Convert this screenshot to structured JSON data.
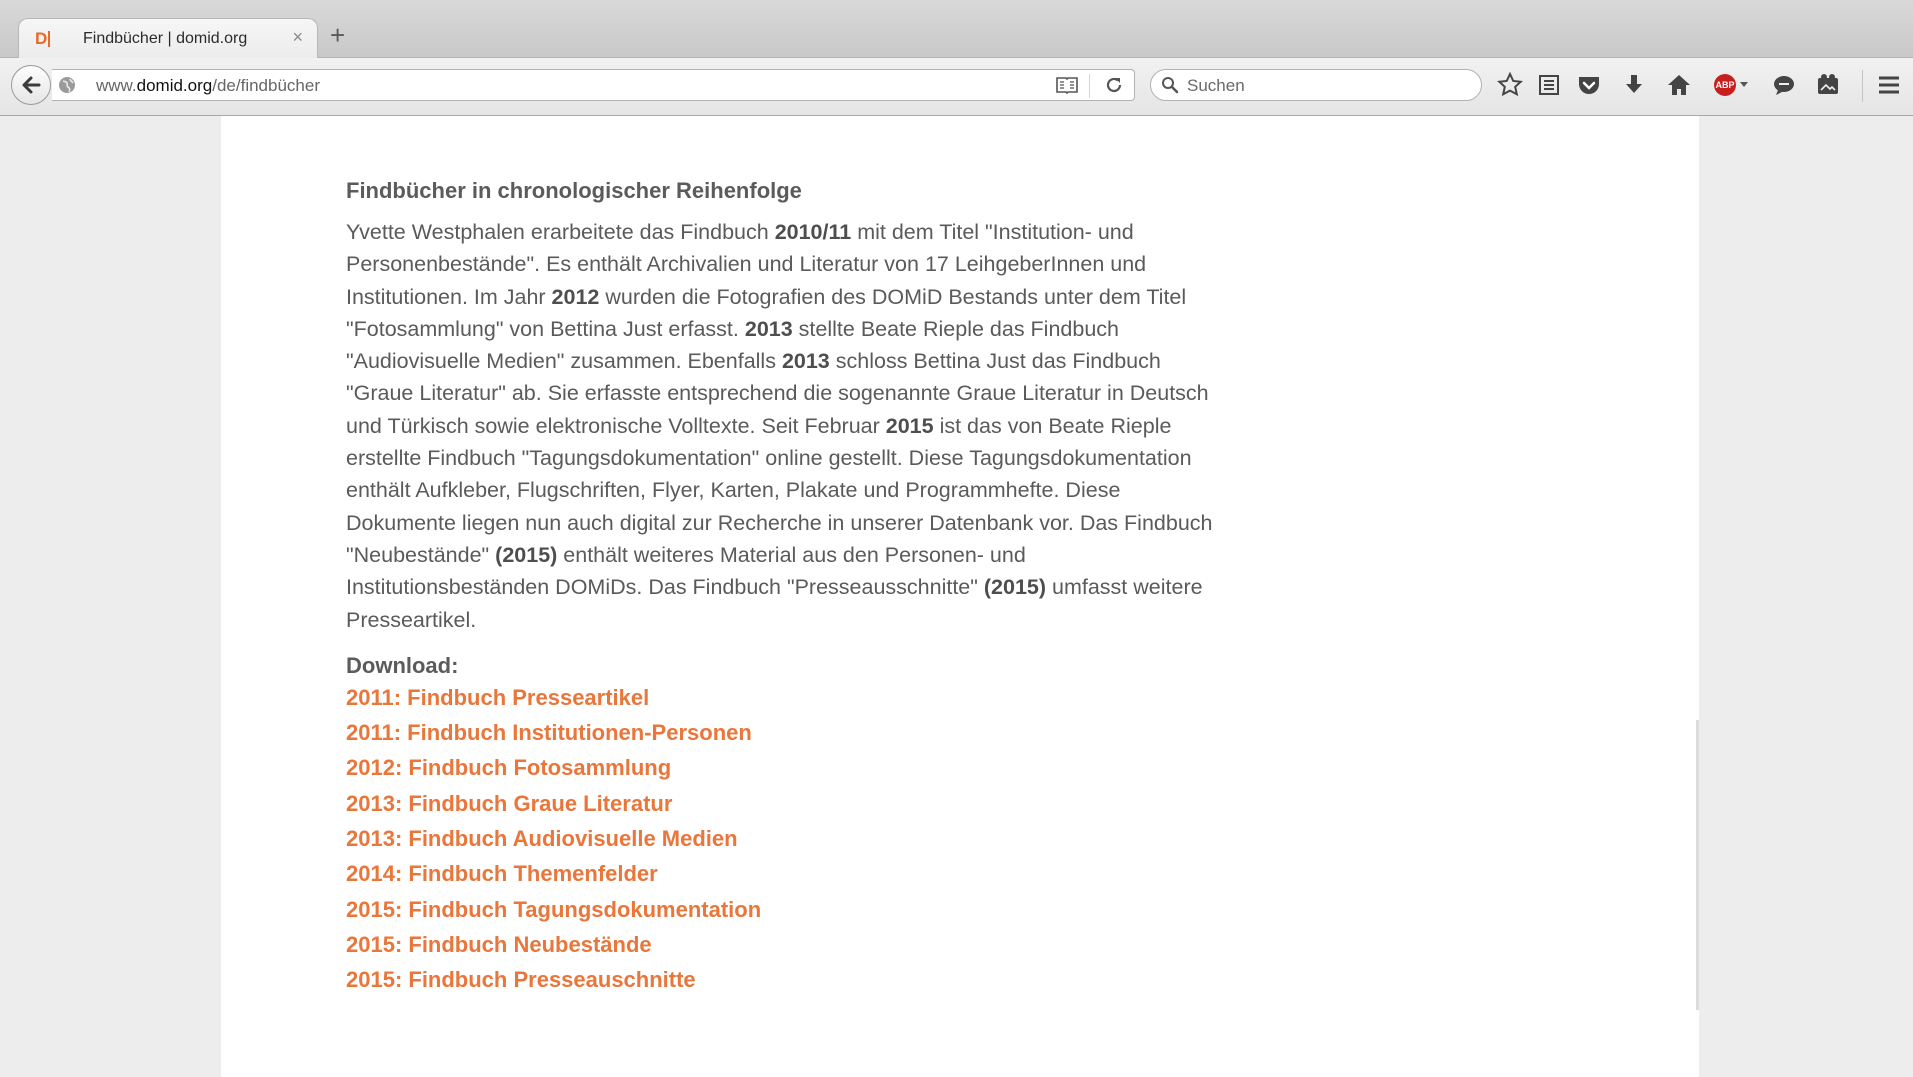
{
  "browser": {
    "tab_title": "Findbücher | domid.org",
    "tab_close": "×",
    "new_tab": "+",
    "url_prefix": "www.",
    "url_domain": "domid.org",
    "url_path": "/de/findbücher",
    "search_placeholder": "Suchen"
  },
  "article": {
    "heading": "Findbücher in chronologischer Reihenfolge",
    "paragraph": [
      {
        "t": "Yvette Westphalen erarbeitete das Findbuch ",
        "b": false
      },
      {
        "t": "2010/11",
        "b": true
      },
      {
        "t": " mit dem Titel \"Institution- und Personenbestände\". Es enthält Archivalien und Literatur von 17 LeihgeberInnen und Institutionen. Im Jahr ",
        "b": false
      },
      {
        "t": "2012",
        "b": true
      },
      {
        "t": " wurden die Fotografien des DOMiD Bestands unter dem Titel \"Fotosammlung\" von Bettina Just erfasst. ",
        "b": false
      },
      {
        "t": "2013",
        "b": true
      },
      {
        "t": " stellte Beate Rieple das Findbuch \"Audiovisuelle Medien\" zusammen. Ebenfalls ",
        "b": false
      },
      {
        "t": "2013",
        "b": true
      },
      {
        "t": " schloss Bettina Just das Findbuch \"Graue Literatur\" ab. Sie erfasste entsprechend die sogenannte Graue Literatur in Deutsch und Türkisch sowie elektronische Volltexte. Seit Februar ",
        "b": false
      },
      {
        "t": "2015",
        "b": true
      },
      {
        "t": " ist das von Beate Rieple erstellte Findbuch \"Tagungsdokumentation\" online gestellt. Diese Tagungsdokumentation enthält Aufkleber, Flugschriften, Flyer, Karten, Plakate und Programmhefte. Diese Dokumente liegen nun auch digital zur Recherche in unserer Datenbank vor. Das Findbuch \"Neubestände\" ",
        "b": false
      },
      {
        "t": "(2015)",
        "b": true
      },
      {
        "t": " enthält weiteres Material aus den Personen- und Institutionsbeständen DOMiDs. Das Findbuch \"Presseausschnitte\" ",
        "b": false
      },
      {
        "t": "(2015)",
        "b": true
      },
      {
        "t": " umfasst weitere Presseartikel.",
        "b": false
      }
    ],
    "download_label": "Download:",
    "downloads": [
      "2011: Findbuch Presseartikel",
      "2011: Findbuch Institutionen-Personen",
      "2012: Findbuch Fotosammlung",
      "2013: Findbuch Graue Literatur",
      "2013: Findbuch Audiovisuelle Medien",
      "2014: Findbuch Themenfelder",
      "2015: Findbuch Tagungsdokumentation",
      "2015: Findbuch Neubestände",
      "2015: Findbuch Presseauschnitte"
    ]
  },
  "colors": {
    "link": "#e9763a",
    "text": "#5a5a5a",
    "brand": "#e8692a"
  },
  "icons": [
    "back-arrow-icon",
    "globe-icon",
    "reader-view-icon",
    "reload-icon",
    "search-icon",
    "bookmark-star-icon",
    "bookmarks-list-icon",
    "pocket-icon",
    "download-icon",
    "home-icon",
    "adblock-plus-icon",
    "chat-icon",
    "screenshot-icon",
    "hamburger-menu-icon"
  ]
}
